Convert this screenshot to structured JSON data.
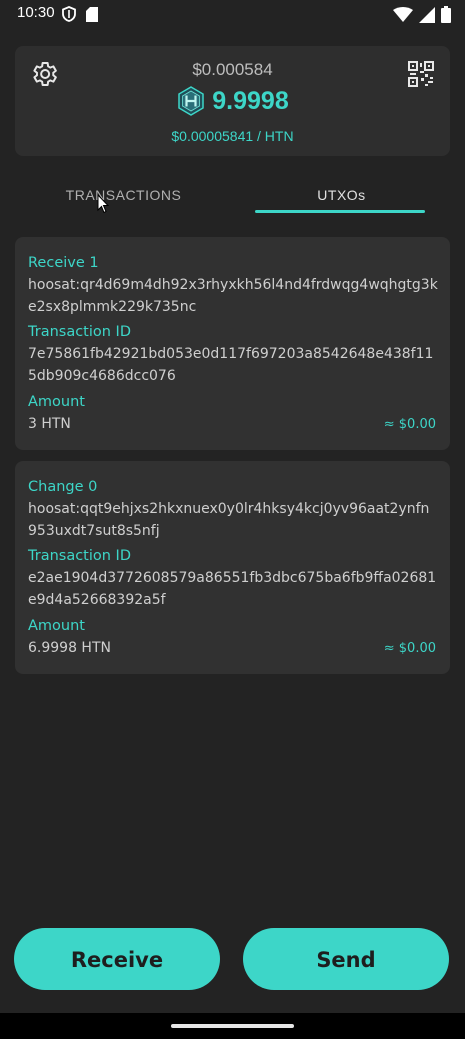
{
  "status_bar": {
    "time": "10:30"
  },
  "balance": {
    "usd_total": "$0.000584",
    "htn_amount": "9.9998",
    "price": "$0.00005841 / HTN"
  },
  "tabs": [
    {
      "label": "TRANSACTIONS",
      "active": false
    },
    {
      "label": "UTXOs",
      "active": true
    }
  ],
  "utxos": [
    {
      "title": "Receive 1",
      "address": "hoosat:qr4d69m4dh92x3rhyxkh56l4nd4frdwqg4wqhgtg3ke2sx8plmmk229k735nc",
      "txid_label": "Transaction ID",
      "txid": "7e75861fb42921bd053e0d117f697203a8542648e438f115db909c4686dcc076",
      "amount_label": "Amount",
      "amount": "3 HTN",
      "usd": "≈ $0.00"
    },
    {
      "title": "Change 0",
      "address": "hoosat:qqt9ehjxs2hkxnuex0y0lr4hksy4kcj0yv96aat2ynfn953uxdt7sut8s5nfj",
      "txid_label": "Transaction ID",
      "txid": "e2ae1904d3772608579a86551fb3dbc675ba6fb9ffa02681e9d4a52668392a5f",
      "amount_label": "Amount",
      "amount": "6.9998 HTN",
      "usd": "≈ $0.00"
    }
  ],
  "actions": {
    "receive_label": "Receive",
    "send_label": "Send"
  },
  "colors": {
    "accent": "#3dd6c8",
    "background": "#232323",
    "card": "#313131"
  },
  "icons": {
    "settings": "gear-icon",
    "qr": "qr-code-icon",
    "logo": "hoosat-logo-icon"
  }
}
